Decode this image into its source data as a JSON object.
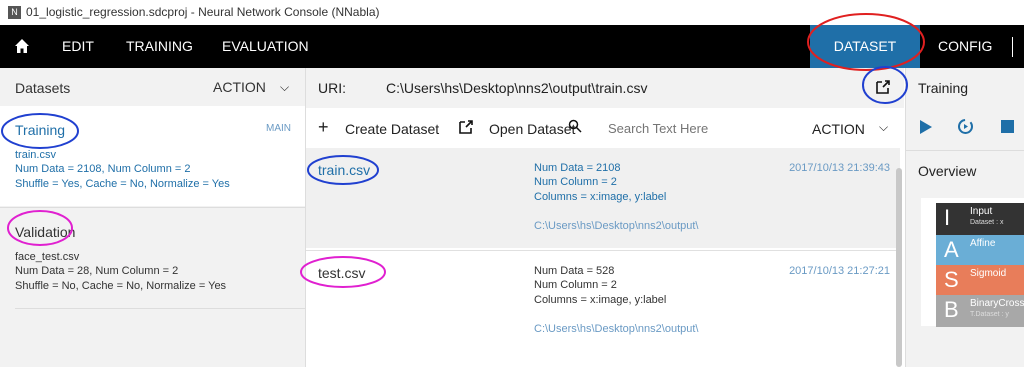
{
  "window": {
    "title": "01_logistic_regression.sdcproj - Neural Network Console (NNabla)",
    "app_icon": "N"
  },
  "nav": {
    "items": [
      "EDIT",
      "TRAINING",
      "EVALUATION"
    ],
    "dataset": "DATASET",
    "config": "CONFIG",
    "home_icon": "home-icon"
  },
  "left_panel": {
    "header": "Datasets",
    "action": "ACTION",
    "training": {
      "title": "Training",
      "badge": "MAIN",
      "file": "train.csv",
      "info": "Num Data = 2108, Num Column = 2",
      "flags": "Shuffle = Yes, Cache = No, Normalize = Yes"
    },
    "validation": {
      "title": "Validation",
      "file": "face_test.csv",
      "info": "Num Data = 28, Num Column = 2",
      "flags": "Shuffle = No, Cache = No, Normalize = Yes"
    }
  },
  "uri": {
    "label": "URI:",
    "value": "C:\\Users\\hs\\Desktop\\nns2\\output\\train.csv"
  },
  "toolbar": {
    "create": "Create Dataset",
    "open": "Open Dataset",
    "search_placeholder": "Search Text Here",
    "action": "ACTION"
  },
  "datasets": [
    {
      "name": "train.csv",
      "num_data": "Num Data = 2108",
      "num_column": "Num Column = 2",
      "columns": "Columns = x:image, y:label",
      "path": "C:\\Users\\hs\\Desktop\\nns2\\output\\",
      "date": "2017/10/13 21:39:43"
    },
    {
      "name": "test.csv",
      "num_data": "Num Data = 528",
      "num_column": "Num Column = 2",
      "columns": "Columns = x:image, y:label",
      "path": "C:\\Users\\hs\\Desktop\\nns2\\output\\",
      "date": "2017/10/13 21:27:21"
    }
  ],
  "right_panel": {
    "title": "Training",
    "overview": "Overview",
    "layers": [
      {
        "letter": "I",
        "name": "Input",
        "sub": "Dataset : x",
        "color": "#333333"
      },
      {
        "letter": "A",
        "name": "Affine",
        "sub": "",
        "color": "#6aaed6"
      },
      {
        "letter": "S",
        "name": "Sigmoid",
        "sub": "",
        "color": "#e87d5a"
      },
      {
        "letter": "B",
        "name": "BinaryCrossEntropy",
        "sub": "T.Dataset : y",
        "color": "#a8a8a8"
      }
    ]
  },
  "colors": {
    "accent": "#1f6fa8",
    "navbar": "#000000"
  }
}
